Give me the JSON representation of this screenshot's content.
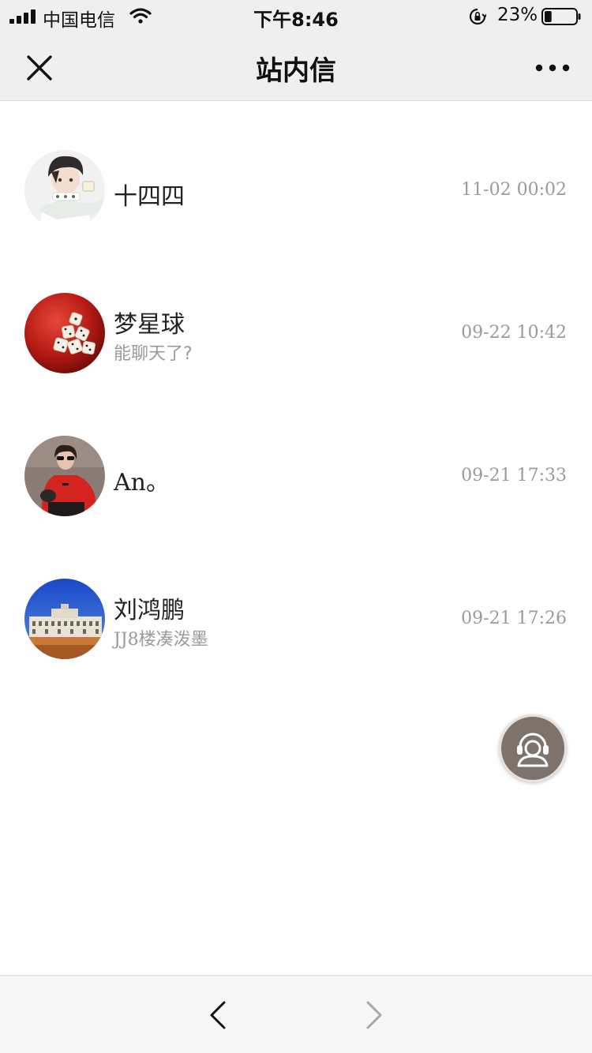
{
  "status_bar": {
    "carrier": "中国电信",
    "time": "下午8:46",
    "battery_percent": "23%",
    "battery_level": 0.23,
    "icons": [
      "signal-icon",
      "wifi-icon",
      "orientation-lock-icon",
      "battery-icon"
    ]
  },
  "nav": {
    "title": "站内信",
    "close_icon": "close-icon",
    "more_icon": "more-icon"
  },
  "messages": [
    {
      "name": "十四四",
      "preview": "",
      "time": "11-02 00:02",
      "avatar": "anime-boy-avatar"
    },
    {
      "name": "梦星球",
      "preview": "能聊天了?",
      "time": "09-22 10:42",
      "avatar": "dice-avatar"
    },
    {
      "name": "An。",
      "preview": "",
      "time": "09-21 17:33",
      "avatar": "woman-red-shirt-avatar"
    },
    {
      "name": "刘鸿鹏",
      "preview": "JJ8楼凑泼墨",
      "time": "09-21 17:26",
      "avatar": "building-photo-avatar"
    }
  ],
  "floating": {
    "icon": "customer-service-icon",
    "color": "#7e736b"
  },
  "toolbar": {
    "back_icon": "chevron-left-icon",
    "forward_icon": "chevron-right-icon"
  }
}
